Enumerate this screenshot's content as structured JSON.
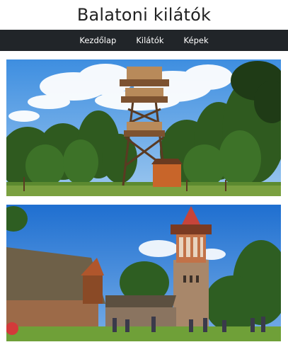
{
  "header": {
    "title": "Balatoni kilátók"
  },
  "nav": {
    "items": [
      {
        "label": "Kezdőlap",
        "name": "nav-link-home"
      },
      {
        "label": "Kilátók",
        "name": "nav-link-towers"
      },
      {
        "label": "Képek",
        "name": "nav-link-images"
      }
    ]
  },
  "gallery": {
    "photos": [
      {
        "name": "wooden-lookout-tower-photo",
        "subject": "wooden observation tower in forest clearing"
      },
      {
        "name": "stone-lookout-tower-photo",
        "subject": "stone tower with thatched buildings and visitors"
      }
    ]
  },
  "colors": {
    "navbar": "#212529",
    "nav_text": "#ffffff",
    "title_text": "#222222"
  }
}
